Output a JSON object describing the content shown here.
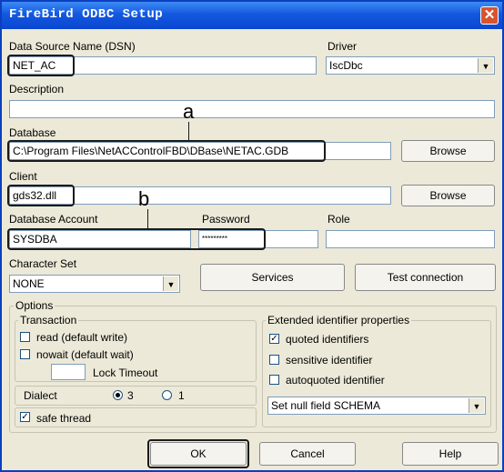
{
  "window": {
    "title": "FireBird ODBC Setup",
    "close_glyph": "✕"
  },
  "dsn": {
    "label": "Data Source Name (DSN)",
    "value": "NET_AC"
  },
  "driver": {
    "label": "Driver",
    "value": "IscDbc"
  },
  "description": {
    "label": "Description",
    "value": ""
  },
  "database": {
    "label": "Database",
    "value": "C:\\Program Files\\NetACControlFBD\\DBase\\NETAC.GDB",
    "browse": "Browse"
  },
  "client": {
    "label": "Client",
    "value": "gds32.dll",
    "browse": "Browse"
  },
  "account": {
    "label": "Database Account",
    "value": "SYSDBA"
  },
  "password": {
    "label": "Password",
    "value": "*********"
  },
  "role": {
    "label": "Role",
    "value": ""
  },
  "charset": {
    "label": "Character Set",
    "value": "NONE"
  },
  "buttons": {
    "services": "Services",
    "test": "Test connection",
    "ok": "OK",
    "cancel": "Cancel",
    "help": "Help"
  },
  "options": {
    "label": "Options",
    "transaction": {
      "label": "Transaction",
      "read": {
        "label": "read (default write)",
        "checked": false
      },
      "nowait": {
        "label": "nowait (default wait)",
        "checked": false
      },
      "lock_timeout": {
        "label": "Lock Timeout",
        "value": ""
      }
    },
    "dialect": {
      "label": "Dialect",
      "option3": "3",
      "option1": "1",
      "selected": "3"
    },
    "safe_thread": {
      "label": "safe thread",
      "checked": true
    },
    "extended": {
      "label": "Extended identifier properties",
      "quoted": {
        "label": "quoted identifiers",
        "checked": true
      },
      "sensitive": {
        "label": "sensitive identifier",
        "checked": false
      },
      "autoquoted": {
        "label": "autoquoted identifier",
        "checked": false
      },
      "null_schema": "Set null field SCHEMA"
    }
  },
  "annotations": {
    "a": "a",
    "b": "b"
  },
  "glyphs": {
    "check": "✓",
    "dropdown": "▼"
  }
}
